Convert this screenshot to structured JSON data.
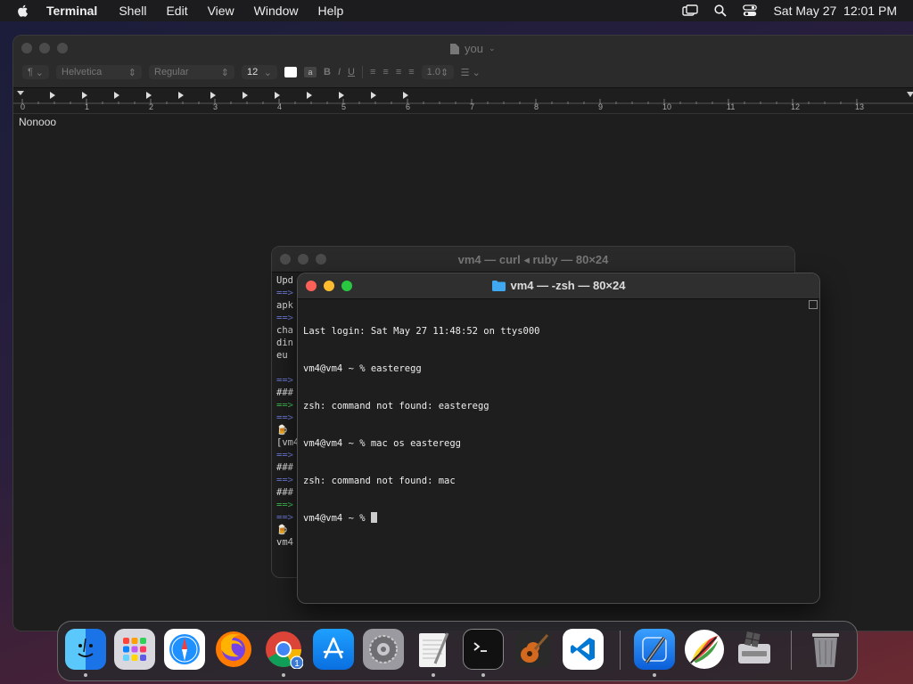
{
  "menubar": {
    "app_name": "Terminal",
    "items": [
      "Shell",
      "Edit",
      "View",
      "Window",
      "Help"
    ],
    "datetime": "Sat May 27  12:01 PM"
  },
  "textedit": {
    "title": "you",
    "paragraph_style": "¶",
    "font_family": "Helvetica",
    "font_style": "Regular",
    "font_size": "12",
    "line_spacing": "1.0",
    "ruler_numbers": [
      "0",
      "1",
      "2",
      "3",
      "4",
      "5",
      "6",
      "7",
      "8",
      "9",
      "10",
      "11",
      "12",
      "13"
    ],
    "content": "Nonooo"
  },
  "terminal_back": {
    "title": "vm4 — curl ◂ ruby — 80×24",
    "lines": [
      {
        "text": "Upd",
        "color": "normal"
      },
      {
        "text": "==>",
        "color": "blue"
      },
      {
        "text": "apk",
        "color": "normal"
      },
      {
        "text": "==>",
        "color": "blue"
      },
      {
        "text": "cha",
        "color": "normal"
      },
      {
        "text": "din",
        "color": "normal"
      },
      {
        "text": "eu",
        "color": "normal"
      },
      {
        "text": "",
        "color": "normal"
      },
      {
        "text": "==>",
        "color": "blue"
      },
      {
        "text": "###",
        "color": "normal"
      },
      {
        "text": "==>",
        "color": "green"
      },
      {
        "text": "==>",
        "color": "blue"
      },
      {
        "text": "🍺",
        "color": "normal"
      },
      {
        "text": "[vm4",
        "color": "normal"
      },
      {
        "text": "==>",
        "color": "blue"
      },
      {
        "text": "###",
        "color": "normal"
      },
      {
        "text": "==>",
        "color": "blue"
      },
      {
        "text": "###",
        "color": "normal"
      },
      {
        "text": "==>",
        "color": "green"
      },
      {
        "text": "==>",
        "color": "blue"
      },
      {
        "text": "🍺",
        "color": "normal"
      },
      {
        "text": "vm4",
        "color": "normal"
      }
    ]
  },
  "terminal_front": {
    "title": "vm4 — -zsh — 80×24",
    "lines": [
      "Last login: Sat May 27 11:48:52 on ttys000",
      "vm4@vm4 ~ % easteregg",
      "zsh: command not found: easteregg",
      "vm4@vm4 ~ % mac os easteregg",
      "zsh: command not found: mac",
      "vm4@vm4 ~ % "
    ]
  },
  "dock": {
    "apps": [
      {
        "name": "finder-icon",
        "color": "#2a8cf0"
      },
      {
        "name": "launchpad-icon",
        "color": "#e5e5ea"
      },
      {
        "name": "safari-icon",
        "color": "#1e90ff"
      },
      {
        "name": "firefox-icon",
        "color": "#ff7b00"
      },
      {
        "name": "chrome-icon",
        "color": "#ffffff"
      },
      {
        "name": "app-store-icon",
        "color": "#1a8cff"
      },
      {
        "name": "system-settings-icon",
        "color": "#8e8e93"
      },
      {
        "name": "textedit-icon",
        "color": "#f2f2f2"
      },
      {
        "name": "terminal-icon",
        "color": "#1e1e1e"
      },
      {
        "name": "garageband-icon",
        "color": "#2a2a2a"
      },
      {
        "name": "vscode-icon",
        "color": "#ffffff"
      },
      {
        "name": "xcode-icon",
        "color": "#1f7ae0"
      },
      {
        "name": "color-picker-icon",
        "color": "#ffffff"
      },
      {
        "name": "boot-camp-assistant-icon",
        "color": "#d9d9d9"
      },
      {
        "name": "trash-icon",
        "color": "#9a9a9a"
      }
    ],
    "chrome_badge": "1"
  }
}
